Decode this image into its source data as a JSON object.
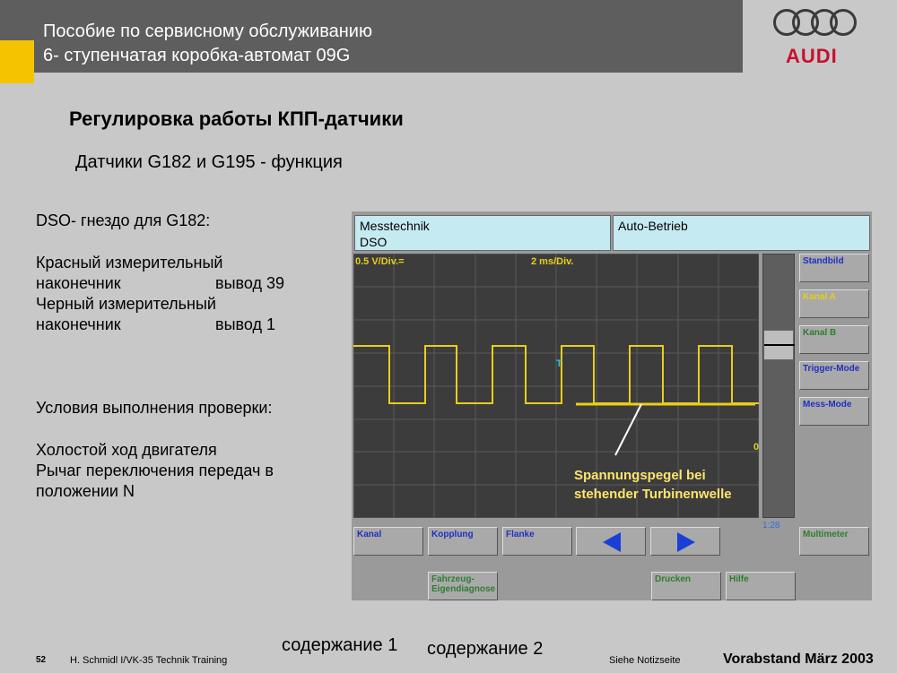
{
  "header": {
    "line1": "Пособие по сервисному обслуживанию",
    "line2": "6- ступенчатая коробка-автомат 09G",
    "logo_text": "AUDI"
  },
  "title": "Регулировка работы КПП-датчики",
  "subtitle": "Датчики G182 и G195 - функция",
  "left_text": {
    "dso_socket": "DSO- гнездо для G182:",
    "red_probe_1": "Красный измерительный",
    "red_probe_2": "наконечник",
    "red_probe_pin": "вывод 39",
    "black_probe_1": "Черный измерительный",
    "black_probe_2": "наконечник",
    "black_probe_pin": "вывод 1",
    "conditions_heading": "Условия выполнения проверки:",
    "condition_1": "Холостой ход двигателя",
    "condition_2": "Рычаг переключения передач в",
    "condition_3": "положении N"
  },
  "tester": {
    "top_left_line1": "Messtechnik",
    "top_left_line2": "DSO",
    "top_right": "Auto-Betrieb",
    "volt_div": "0.5 V/Div.=",
    "time_div": "2 ms/Div.",
    "trigger_marker": "T",
    "zero_marker": "0",
    "ratio": "1:28",
    "side_buttons": [
      "Standbild",
      "Kanal A",
      "Kanal B",
      "Trigger-Mode",
      "Mess-Mode"
    ],
    "multimeter": "Multimeter",
    "bottom_buttons": [
      "Kanal",
      "Kopplung",
      "Flanke"
    ],
    "diag_button_1": "Fahrzeug-",
    "diag_button_2": "Eigendiagnose",
    "print_button": "Drucken",
    "help_button": "Hilfe",
    "colors": {
      "screen_bg": "#c6eaf2",
      "signal": "#e6cf1a",
      "arrow": "#1a3fd6"
    }
  },
  "annotation": {
    "line1": "Spannungspegel bei",
    "line2": "stehender Turbinenwelle"
  },
  "footer": {
    "page": "52",
    "author": "H. Schmidl I/VK-35  Technik Training",
    "link1": "содержание 1",
    "link2": "содержание 2",
    "note": "Siehe Notizseite",
    "status": "Vorabstand   März 2003"
  }
}
